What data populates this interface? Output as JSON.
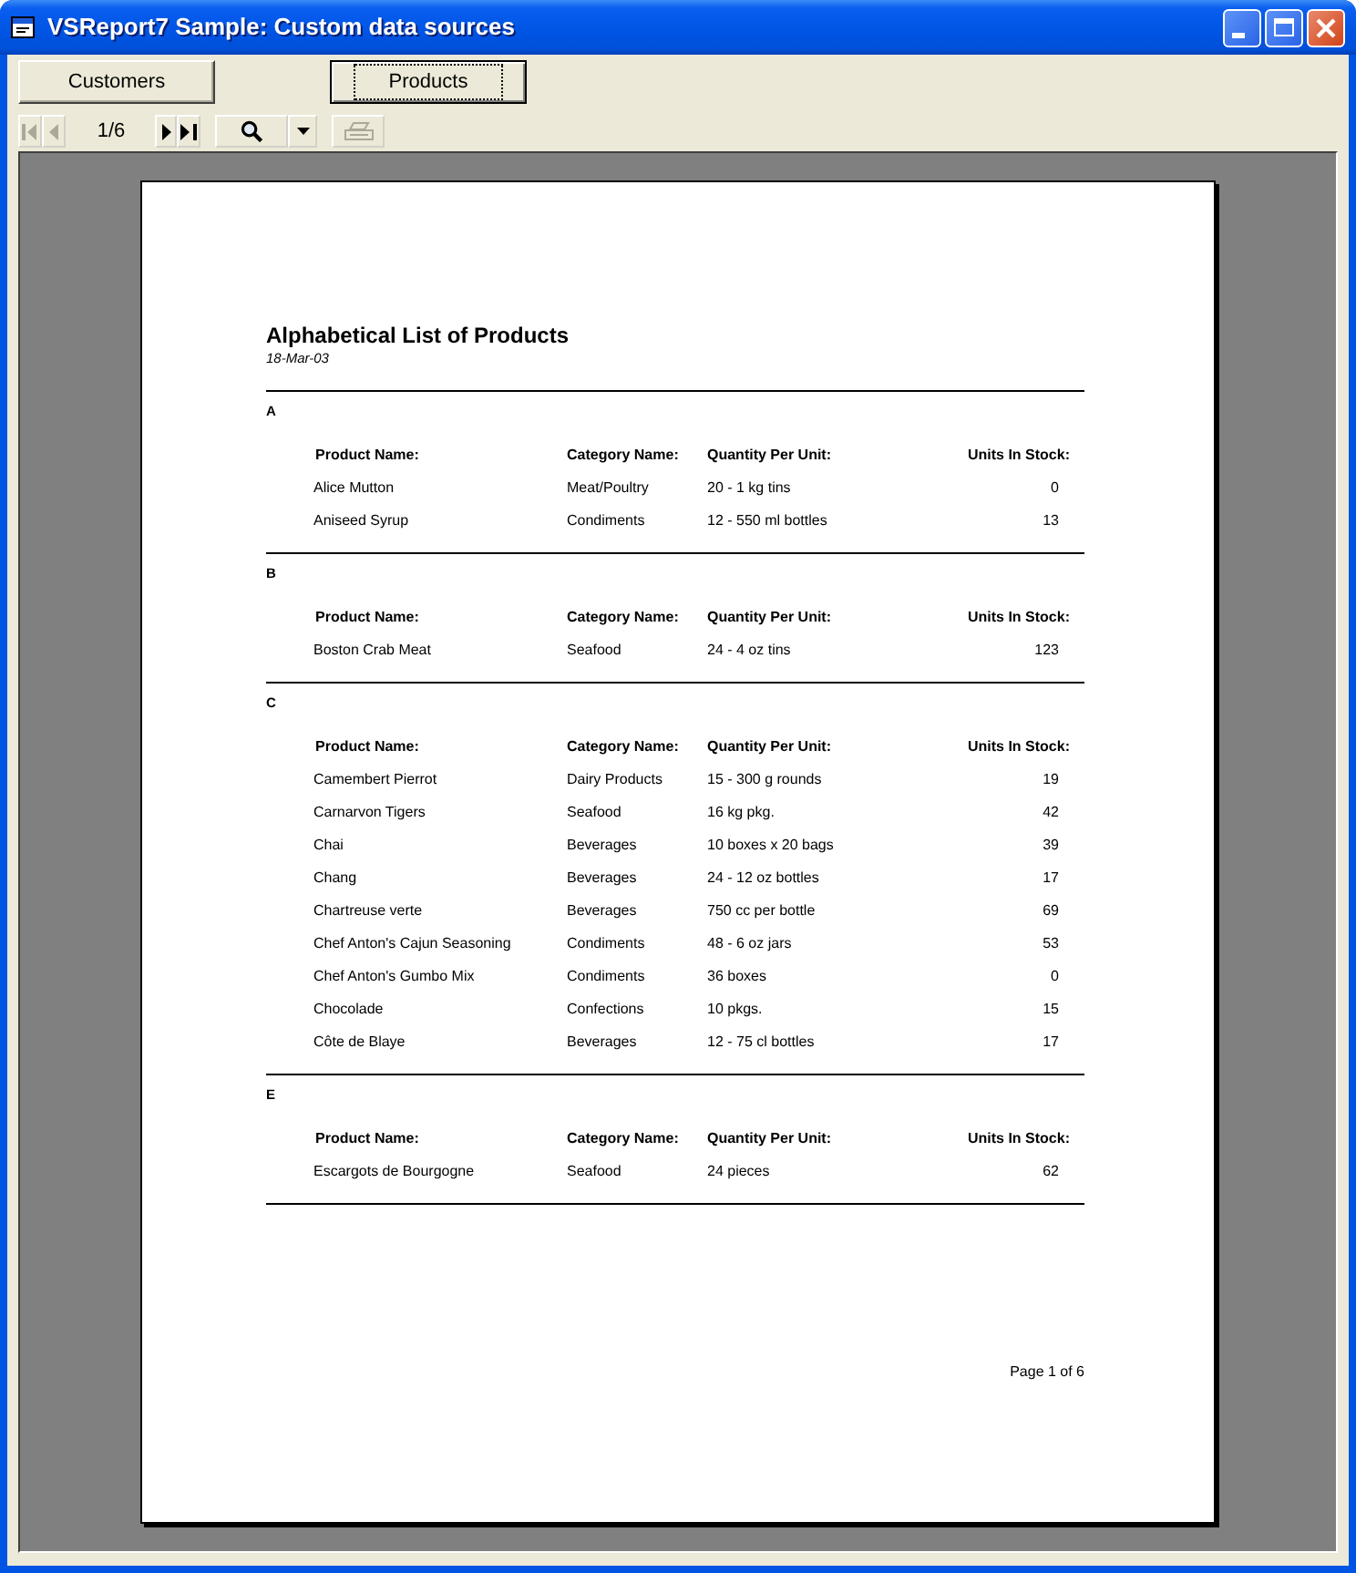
{
  "window": {
    "title": "VSReport7 Sample: Custom data sources"
  },
  "report_buttons": [
    {
      "label": "Customers",
      "selected": false
    },
    {
      "label": "Products",
      "selected": true
    }
  ],
  "toolbar": {
    "items": [
      {
        "kind": "first",
        "disabled": true
      },
      {
        "kind": "prev",
        "disabled": true
      },
      {
        "kind": "page",
        "text": "1/6"
      },
      {
        "kind": "next",
        "disabled": false
      },
      {
        "kind": "last",
        "disabled": false
      },
      {
        "kind": "zoom",
        "disabled": false
      },
      {
        "kind": "dropdown",
        "disabled": false
      },
      {
        "kind": "print",
        "disabled": true
      }
    ]
  },
  "report": {
    "title": "Alphabetical List of Products",
    "date": "18-Mar-03",
    "groups": [
      {
        "letter": "A",
        "columns": [
          "Product Name:",
          "Category Name:",
          "Quantity Per Unit:",
          "Units In Stock:"
        ],
        "rows": [
          [
            "Alice Mutton",
            "Meat/Poultry",
            "20 - 1 kg tins",
            "0"
          ],
          [
            "Aniseed Syrup",
            "Condiments",
            "12 - 550 ml bottles",
            "13"
          ]
        ]
      },
      {
        "letter": "B",
        "columns": [
          "Product Name:",
          "Category Name:",
          "Quantity Per Unit:",
          "Units In Stock:"
        ],
        "rows": [
          [
            "Boston Crab Meat",
            "Seafood",
            "24 - 4 oz tins",
            "123"
          ]
        ]
      },
      {
        "letter": "C",
        "columns": [
          "Product Name:",
          "Category Name:",
          "Quantity Per Unit:",
          "Units In Stock:"
        ],
        "rows": [
          [
            "Camembert Pierrot",
            "Dairy Products",
            "15 - 300 g rounds",
            "19"
          ],
          [
            "Carnarvon Tigers",
            "Seafood",
            "16 kg pkg.",
            "42"
          ],
          [
            "Chai",
            "Beverages",
            "10 boxes x 20 bags",
            "39"
          ],
          [
            "Chang",
            "Beverages",
            "24 - 12 oz bottles",
            "17"
          ],
          [
            "Chartreuse verte",
            "Beverages",
            "750 cc per bottle",
            "69"
          ],
          [
            "Chef Anton's Cajun Seasoning",
            "Condiments",
            "48 - 6 oz jars",
            "53"
          ],
          [
            "Chef Anton's Gumbo Mix",
            "Condiments",
            "36 boxes",
            "0"
          ],
          [
            "Chocolade",
            "Confections",
            "10 pkgs.",
            "15"
          ],
          [
            "Côte de Blaye",
            "Beverages",
            "12 - 75 cl bottles",
            "17"
          ]
        ]
      },
      {
        "letter": "E",
        "columns": [
          "Product Name:",
          "Category Name:",
          "Quantity Per Unit:",
          "Units In Stock:"
        ],
        "rows": [
          [
            "Escargots de Bourgogne",
            "Seafood",
            "24 pieces",
            "62"
          ]
        ]
      }
    ],
    "footer": "Page 1 of 6"
  }
}
